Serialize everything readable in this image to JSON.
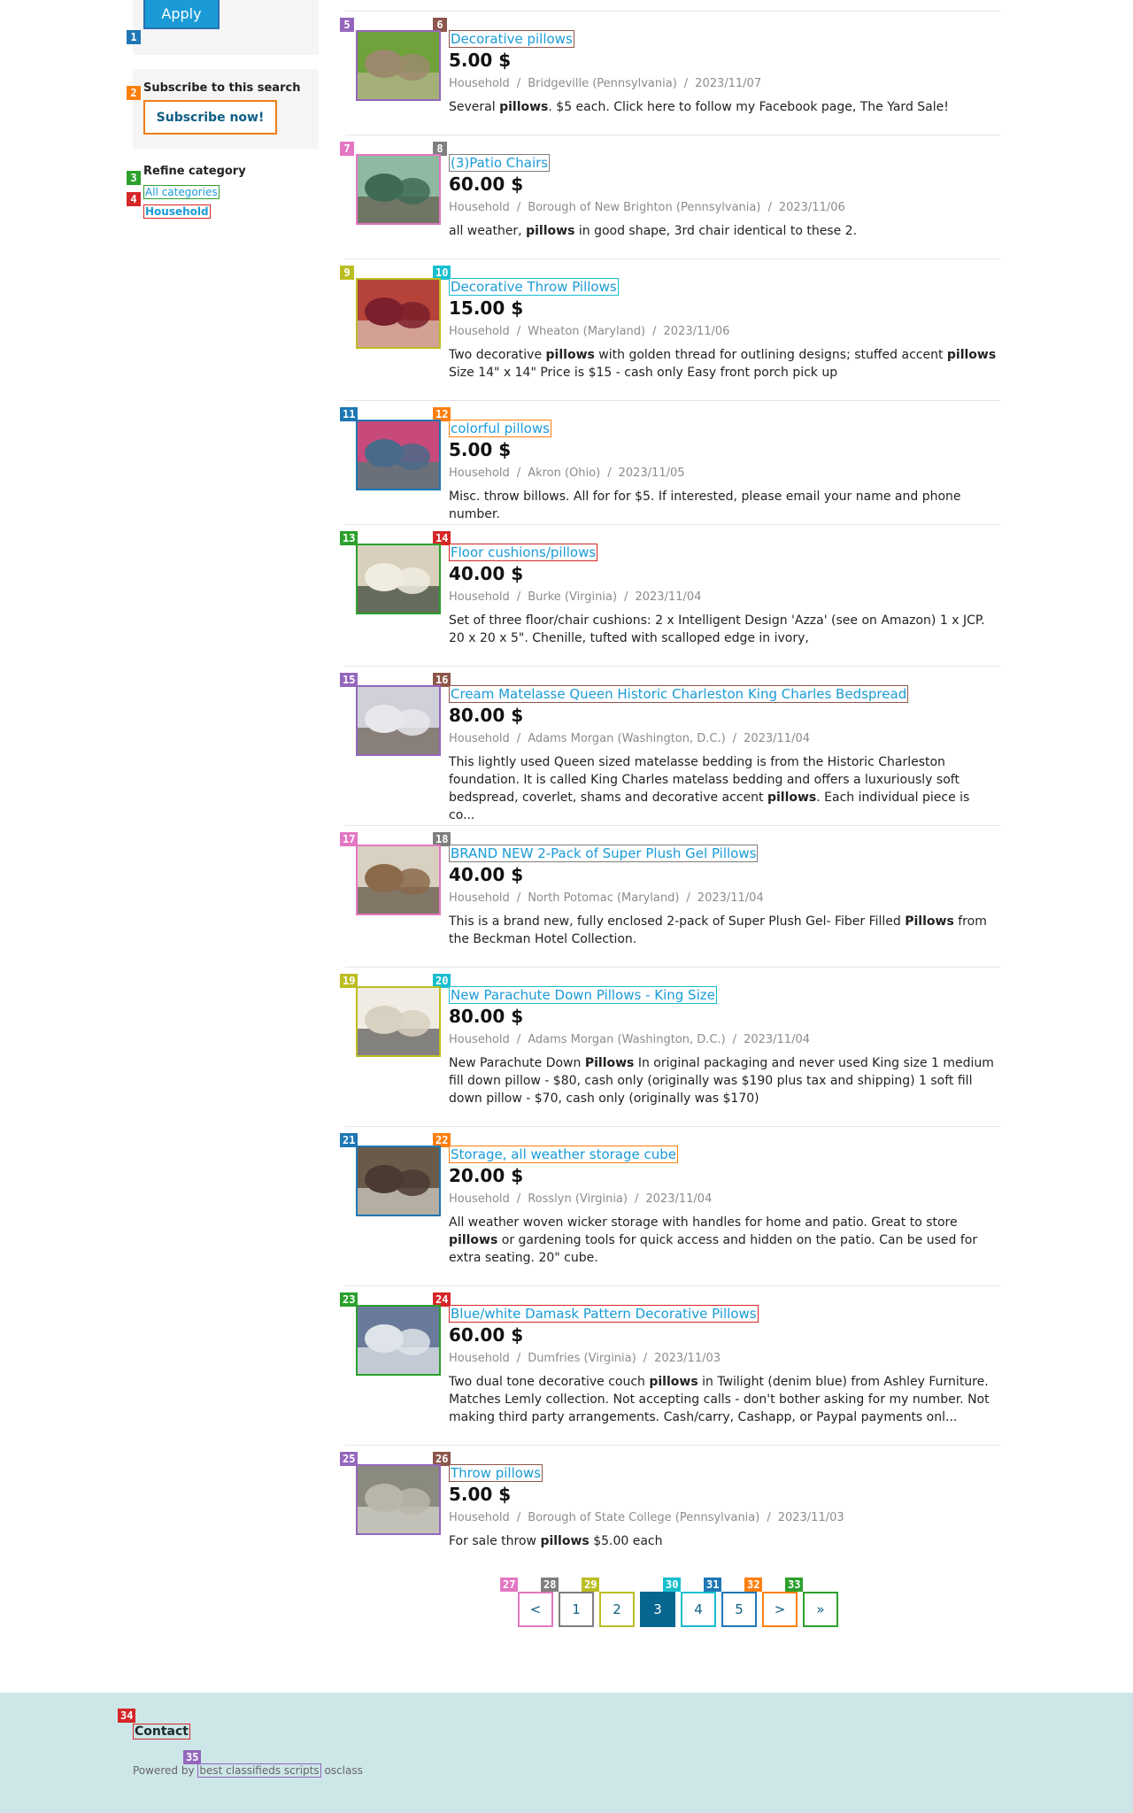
{
  "sidebar": {
    "apply_label": "Apply",
    "subscribe_title": "Subscribe to this search",
    "subscribe_button": "Subscribe now!",
    "refine_title": "Refine category",
    "categories": [
      "All categories",
      "Household"
    ]
  },
  "listings": [
    {
      "title": "Decorative pillows",
      "price": "5.00 $",
      "category": "Household",
      "location": "Bridgeville (Pennsylvania)",
      "date": "2023/11/07",
      "desc_html": "Several <b>pillows</b>. $5 each. Click here to follow my Facebook page, The Yard Sale!"
    },
    {
      "title": "(3)Patio Chairs",
      "price": "60.00 $",
      "category": "Household",
      "location": "Borough of New Brighton (Pennsylvania)",
      "date": "2023/11/06",
      "desc_html": "all weather, <b>pillows</b> in good shape, 3rd chair identical to these 2."
    },
    {
      "title": "Decorative Throw Pillows",
      "price": "15.00 $",
      "category": "Household",
      "location": "Wheaton (Maryland)",
      "date": "2023/11/06",
      "desc_html": "Two decorative <b>pillows</b> with golden thread for outlining designs; stuffed accent <b>pillows</b> Size 14\" x 14\" Price is $15 - cash only Easy front porch pick up"
    },
    {
      "title": "colorful pillows",
      "price": "5.00 $",
      "category": "Household",
      "location": "Akron (Ohio)",
      "date": "2023/11/05",
      "desc_html": "Misc. throw billows. All for for $5. If interested, please email your name and phone number."
    },
    {
      "title": "Floor cushions/pillows",
      "price": "40.00 $",
      "category": "Household",
      "location": "Burke (Virginia)",
      "date": "2023/11/04",
      "desc_html": "Set of three floor/chair cushions: 2 x Intelligent Design 'Azza' (see on Amazon) 1 x JCP. 20 x 20 x 5\". Chenille, tufted with scalloped edge in ivory,"
    },
    {
      "title": "Cream Matelasse Queen Historic Charleston King Charles Bedspread",
      "price": "80.00 $",
      "category": "Household",
      "location": "Adams Morgan (Washington, D.C.)",
      "date": "2023/11/04",
      "desc_html": "This lightly used Queen sized matelasse bedding is from the Historic Charleston foundation. It is called King Charles matelass bedding and offers a luxuriously soft bedspread, coverlet, shams and decorative accent <b>pillows</b>. Each individual piece is co..."
    },
    {
      "title": "BRAND NEW 2-Pack of Super Plush Gel Pillows",
      "price": "40.00 $",
      "category": "Household",
      "location": "North Potomac (Maryland)",
      "date": "2023/11/04",
      "desc_html": "This is a brand new, fully enclosed 2-pack of Super Plush Gel- Fiber Filled <b>Pillows</b> from the Beckman Hotel Collection."
    },
    {
      "title": "New Parachute Down Pillows - King Size",
      "price": "80.00 $",
      "category": "Household",
      "location": "Adams Morgan (Washington, D.C.)",
      "date": "2023/11/04",
      "desc_html": "New Parachute Down <b>Pillows</b> In original packaging and never used King size 1 medium fill down pillow - $80, cash only (originally was $190 plus tax and shipping) 1 soft fill down pillow - $70, cash only (originally was $170)"
    },
    {
      "title": "Storage, all weather storage cube",
      "price": "20.00 $",
      "category": "Household",
      "location": "Rosslyn (Virginia)",
      "date": "2023/11/04",
      "desc_html": "All weather woven wicker storage with handles for home and patio. Great to store <b>pillows</b> or gardening tools for quick access and hidden on the patio. Can be used for extra seating. 20\" cube."
    },
    {
      "title": "Blue/white Damask Pattern Decorative Pillows",
      "price": "60.00 $",
      "category": "Household",
      "location": "Dumfries (Virginia)",
      "date": "2023/11/03",
      "desc_html": "Two dual tone decorative couch <b>pillows</b> in Twilight (denim blue) from Ashley Furniture. Matches Lemly collection. Not accepting calls - don't bother asking for my number. Not making third party arrangements. Cash/carry, Cashapp, or Paypal payments onl..."
    },
    {
      "title": "Throw pillows",
      "price": "5.00 $",
      "category": "Household",
      "location": "Borough of State College (Pennsylvania)",
      "date": "2023/11/03",
      "desc_html": "For sale throw <b>pillows</b> $5.00 each"
    }
  ],
  "pagination": [
    "<",
    "1",
    "2",
    "3",
    "4",
    "5",
    ">",
    "»"
  ],
  "pagination_current": "3",
  "footer": {
    "contact": "Contact",
    "powered_prefix": "Powered by",
    "powered_link": "best classifieds scripts",
    "powered_suffix": "osclass"
  },
  "tags": [
    "1",
    "2",
    "3",
    "4",
    "5",
    "6",
    "7",
    "8",
    "9",
    "10",
    "11",
    "12",
    "13",
    "14",
    "15",
    "16",
    "17",
    "18",
    "19",
    "20",
    "21",
    "22",
    "23",
    "24",
    "25",
    "26",
    "27",
    "28",
    "29",
    "30",
    "31",
    "32",
    "33",
    "34",
    "35"
  ],
  "tag_colors": [
    "#1f77b4",
    "#ff7f0e",
    "#2ca02c",
    "#d62728",
    "#9467bd",
    "#8c564b",
    "#e377c2",
    "#7f7f7f",
    "#bcbd22",
    "#17becf"
  ]
}
